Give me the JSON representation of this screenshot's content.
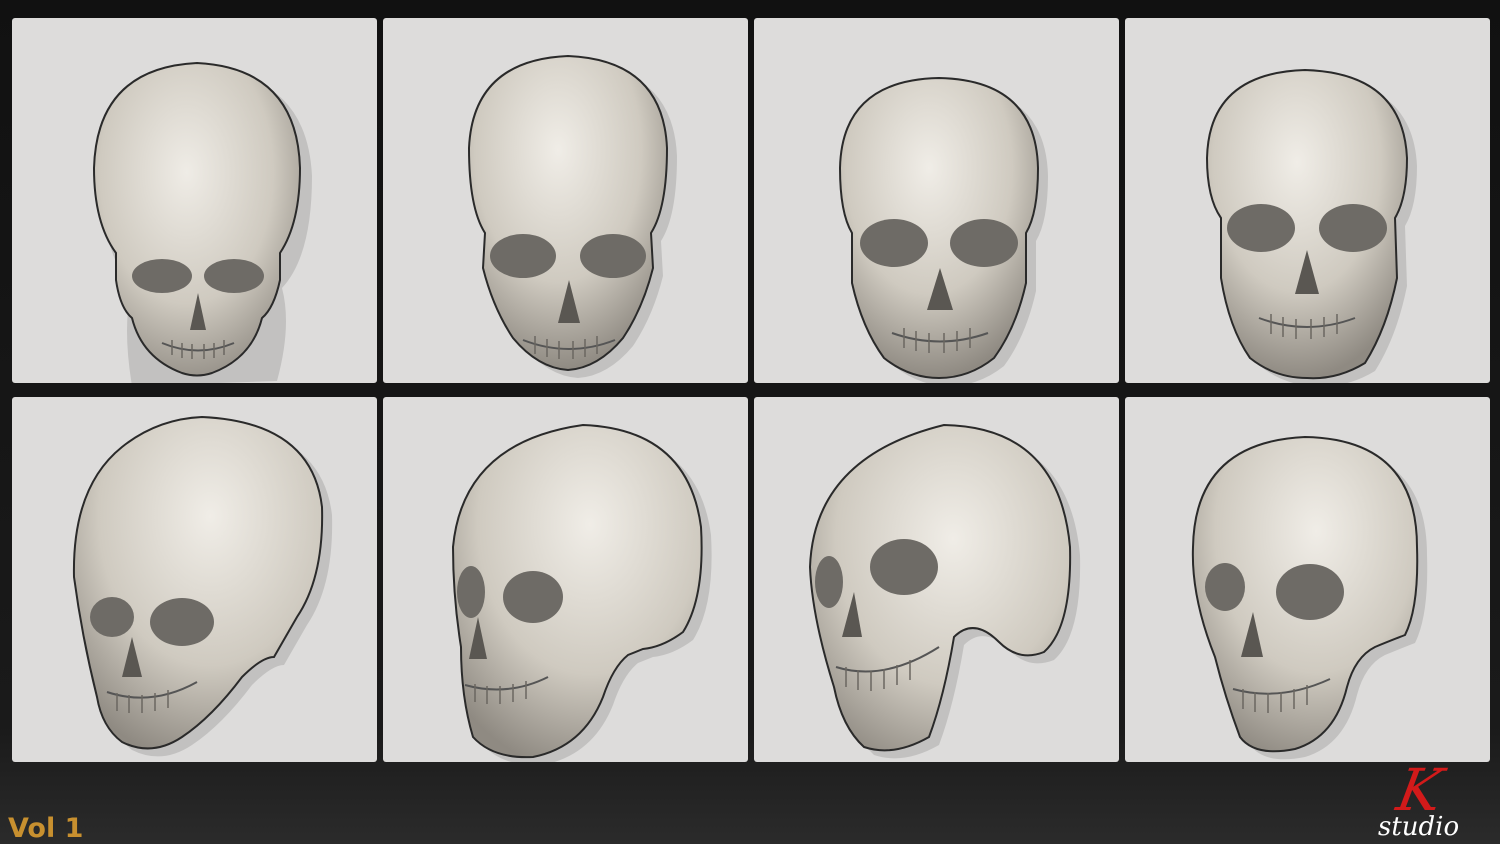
{
  "footer": {
    "volume_label": "Vol 1",
    "logo_mark": "K",
    "logo_word": "studio"
  },
  "colors": {
    "background": "#111111",
    "panel": "#dddcdb",
    "bone": "#d6d2c8",
    "volume_label": "#c8902f",
    "logo_mark": "#d21a1a",
    "logo_word": "#ffffff"
  },
  "panels": [
    {
      "name": "skull-front-high-angle",
      "view": "front",
      "icon": "skull-icon"
    },
    {
      "name": "skull-front-slightly-high",
      "view": "front",
      "icon": "skull-icon"
    },
    {
      "name": "skull-front-level",
      "view": "front",
      "icon": "skull-icon"
    },
    {
      "name": "skull-front-low-angle",
      "view": "front",
      "icon": "skull-icon"
    },
    {
      "name": "skull-three-quarter-high-left",
      "view": "three-quarter",
      "icon": "skull-icon"
    },
    {
      "name": "skull-side-left",
      "view": "three-quarter",
      "icon": "skull-icon"
    },
    {
      "name": "skull-three-quarter-low-left",
      "view": "three-quarter",
      "icon": "skull-icon"
    },
    {
      "name": "skull-three-quarter-left",
      "view": "three-quarter",
      "icon": "skull-icon"
    }
  ]
}
